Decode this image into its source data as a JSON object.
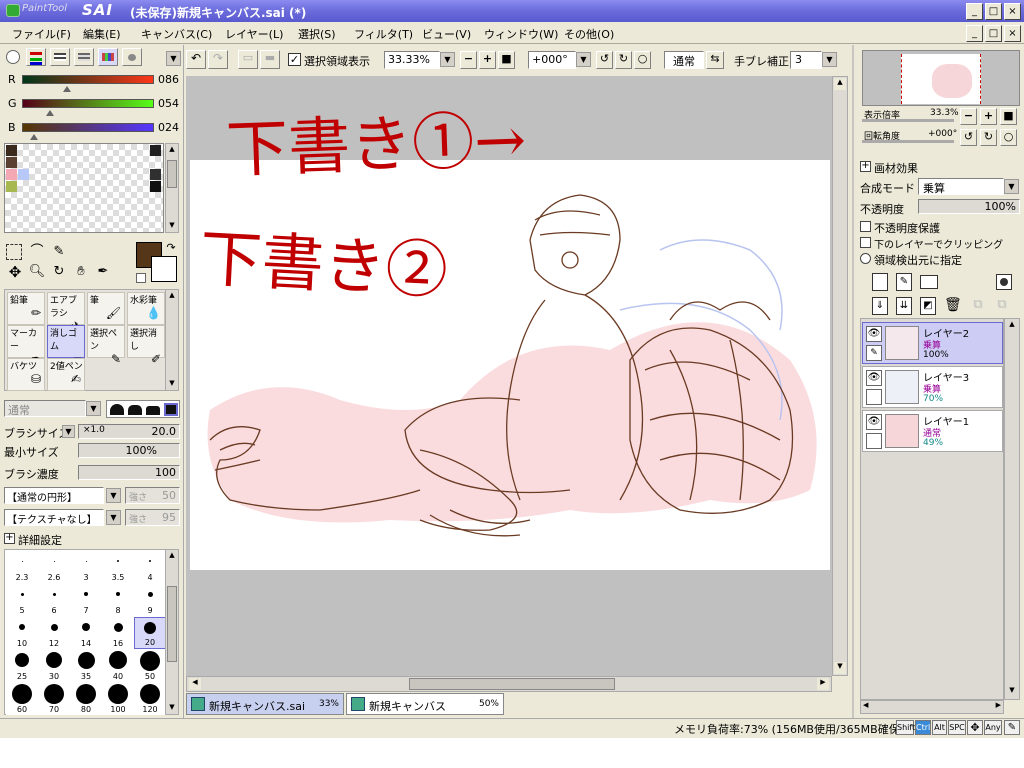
{
  "window": {
    "title": "(未保存)新規キャンバス.sai (*)",
    "logo_small": "PaintTool",
    "logo_big": "SAI"
  },
  "menu": [
    "ファイル(F)",
    "編集(E)",
    "キャンバス(C)",
    "レイヤー(L)",
    "選択(S)",
    "フィルタ(T)",
    "ビュー(V)",
    "ウィンドウ(W)",
    "その他(O)"
  ],
  "toolbar": {
    "selection_display": "選択領域表示",
    "zoom": "33.33%",
    "angle": "+000°",
    "blend": "通常",
    "stabilizer_label": "手ブレ補正",
    "stabilizer": "3"
  },
  "color": {
    "r_label": "R",
    "g_label": "G",
    "b_label": "B",
    "r": "086",
    "g": "054",
    "b": "024",
    "r_fraction": 0.34,
    "g_fraction": 0.21,
    "b_fraction": 0.09,
    "primary": "#563618",
    "swatches": [
      "#3a2a1e",
      "#5a4030",
      "#f4a8b4",
      "#b8c8f8",
      "#a8b850",
      "#202020",
      "#303030",
      "#101010"
    ]
  },
  "tools": [
    {
      "label": "鉛筆",
      "icon": "pencil-icon"
    },
    {
      "label": "エアブラシ",
      "icon": "airbrush-icon"
    },
    {
      "label": "筆",
      "icon": "brush-icon"
    },
    {
      "label": "水彩筆",
      "icon": "watercolor-icon"
    },
    {
      "label": "マーカー",
      "icon": "marker-icon"
    },
    {
      "label": "消しゴム",
      "icon": "eraser-icon"
    },
    {
      "label": "選択ペン",
      "icon": "select-pen-icon"
    },
    {
      "label": "選択消し",
      "icon": "select-eraser-icon"
    },
    {
      "label": "バケツ",
      "icon": "bucket-icon"
    },
    {
      "label": "2値ペン",
      "icon": "binary-pen-icon"
    }
  ],
  "brush": {
    "blend_mode": "通常",
    "size_label": "ブラシサイズ",
    "size_mult": "×1.0",
    "size": "20.0",
    "min_size_label": "最小サイズ",
    "min_size": "100%",
    "density_label": "ブラシ濃度",
    "density": "100",
    "shape": "【通常の円形】",
    "shape_strength_label": "強さ",
    "shape_strength": "50",
    "texture": "【テクスチャなし】",
    "texture_strength_label": "強さ",
    "texture_strength": "95",
    "detail_label": "詳細設定",
    "sizes": [
      "2.3",
      "2.6",
      "3",
      "3.5",
      "4",
      "5",
      "6",
      "7",
      "8",
      "9",
      "10",
      "12",
      "14",
      "16",
      "20",
      "25",
      "30",
      "35",
      "40",
      "50",
      "60",
      "70",
      "80",
      "100",
      "120"
    ]
  },
  "navigator": {
    "zoom_label": "表示倍率",
    "zoom": "33.3%",
    "rotation_label": "回転角度",
    "rotation": "+000°"
  },
  "layer_panel": {
    "effects_label": "画材効果",
    "blend_label": "合成モード",
    "blend": "乗算",
    "opacity_label": "不透明度",
    "opacity": "100%",
    "protect_label": "不透明度保護",
    "clip_label": "下のレイヤーでクリッピング",
    "source_label": "領域検出元に指定"
  },
  "layers": [
    {
      "name": "レイヤー2",
      "mode": "乗算",
      "opacity": "100%",
      "selected": true
    },
    {
      "name": "レイヤー3",
      "mode": "乗算",
      "opacity": "70%",
      "selected": false
    },
    {
      "name": "レイヤー1",
      "mode": "通常",
      "opacity": "49%",
      "selected": false
    }
  ],
  "tabs": [
    {
      "name": "新規キャンバス.sai",
      "zoom": "33%",
      "selected": true
    },
    {
      "name": "新規キャンバス",
      "zoom": "50%",
      "selected": false
    }
  ],
  "status": {
    "memory": "メモリ負荷率:73% (156MB使用/365MB確保)",
    "keys": [
      "Shift",
      "Ctrl",
      "Alt",
      "SPC",
      "Any"
    ]
  },
  "sketch_text": {
    "line1": "下書き①→",
    "line2": "下書き②"
  }
}
